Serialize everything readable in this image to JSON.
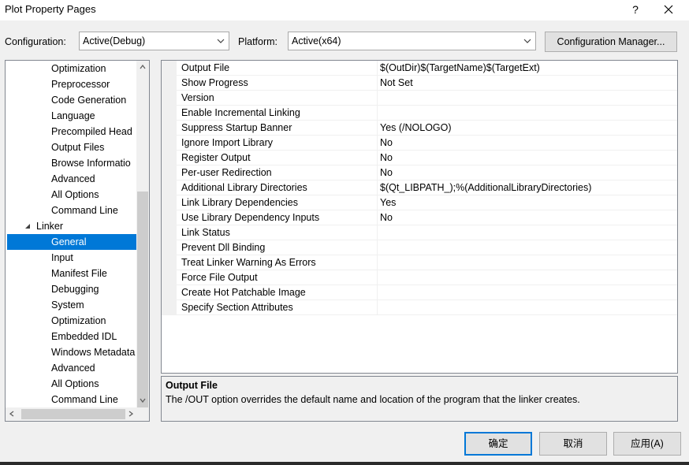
{
  "window": {
    "title": "Plot Property Pages",
    "help_label": "?",
    "icons": {
      "close": "close-icon"
    }
  },
  "config_bar": {
    "configuration_label": "Configuration:",
    "configuration_value": "Active(Debug)",
    "platform_label": "Platform:",
    "platform_value": "Active(x64)",
    "manager_button": "Configuration Manager..."
  },
  "tree": {
    "items": [
      "Optimization",
      "Preprocessor",
      "Code Generation",
      "Language",
      "Precompiled Head",
      "Output Files",
      "Browse Informatio",
      "Advanced",
      "All Options",
      "Command Line",
      "Linker",
      "General",
      "Input",
      "Manifest File",
      "Debugging",
      "System",
      "Optimization",
      "Embedded IDL",
      "Windows Metadata",
      "Advanced",
      "All Options",
      "Command Line"
    ],
    "selected": "General"
  },
  "properties": [
    {
      "name": "Output File",
      "value": "$(OutDir)$(TargetName)$(TargetExt)"
    },
    {
      "name": "Show Progress",
      "value": "Not Set"
    },
    {
      "name": "Version",
      "value": ""
    },
    {
      "name": "Enable Incremental Linking",
      "value": ""
    },
    {
      "name": "Suppress Startup Banner",
      "value": "Yes (/NOLOGO)"
    },
    {
      "name": "Ignore Import Library",
      "value": "No"
    },
    {
      "name": "Register Output",
      "value": "No"
    },
    {
      "name": "Per-user Redirection",
      "value": "No"
    },
    {
      "name": "Additional Library Directories",
      "value": "$(Qt_LIBPATH_);%(AdditionalLibraryDirectories)"
    },
    {
      "name": "Link Library Dependencies",
      "value": "Yes"
    },
    {
      "name": "Use Library Dependency Inputs",
      "value": "No"
    },
    {
      "name": "Link Status",
      "value": ""
    },
    {
      "name": "Prevent Dll Binding",
      "value": ""
    },
    {
      "name": "Treat Linker Warning As Errors",
      "value": ""
    },
    {
      "name": "Force File Output",
      "value": ""
    },
    {
      "name": "Create Hot Patchable Image",
      "value": ""
    },
    {
      "name": "Specify Section Attributes",
      "value": ""
    }
  ],
  "description": {
    "title": "Output File",
    "text": "The /OUT option overrides the default name and location of the program that the linker creates."
  },
  "buttons": {
    "ok": "确定",
    "cancel": "取消",
    "apply": "应用(A)"
  },
  "colors": {
    "selection": "#0078d7",
    "background": "#f0f0f0"
  }
}
